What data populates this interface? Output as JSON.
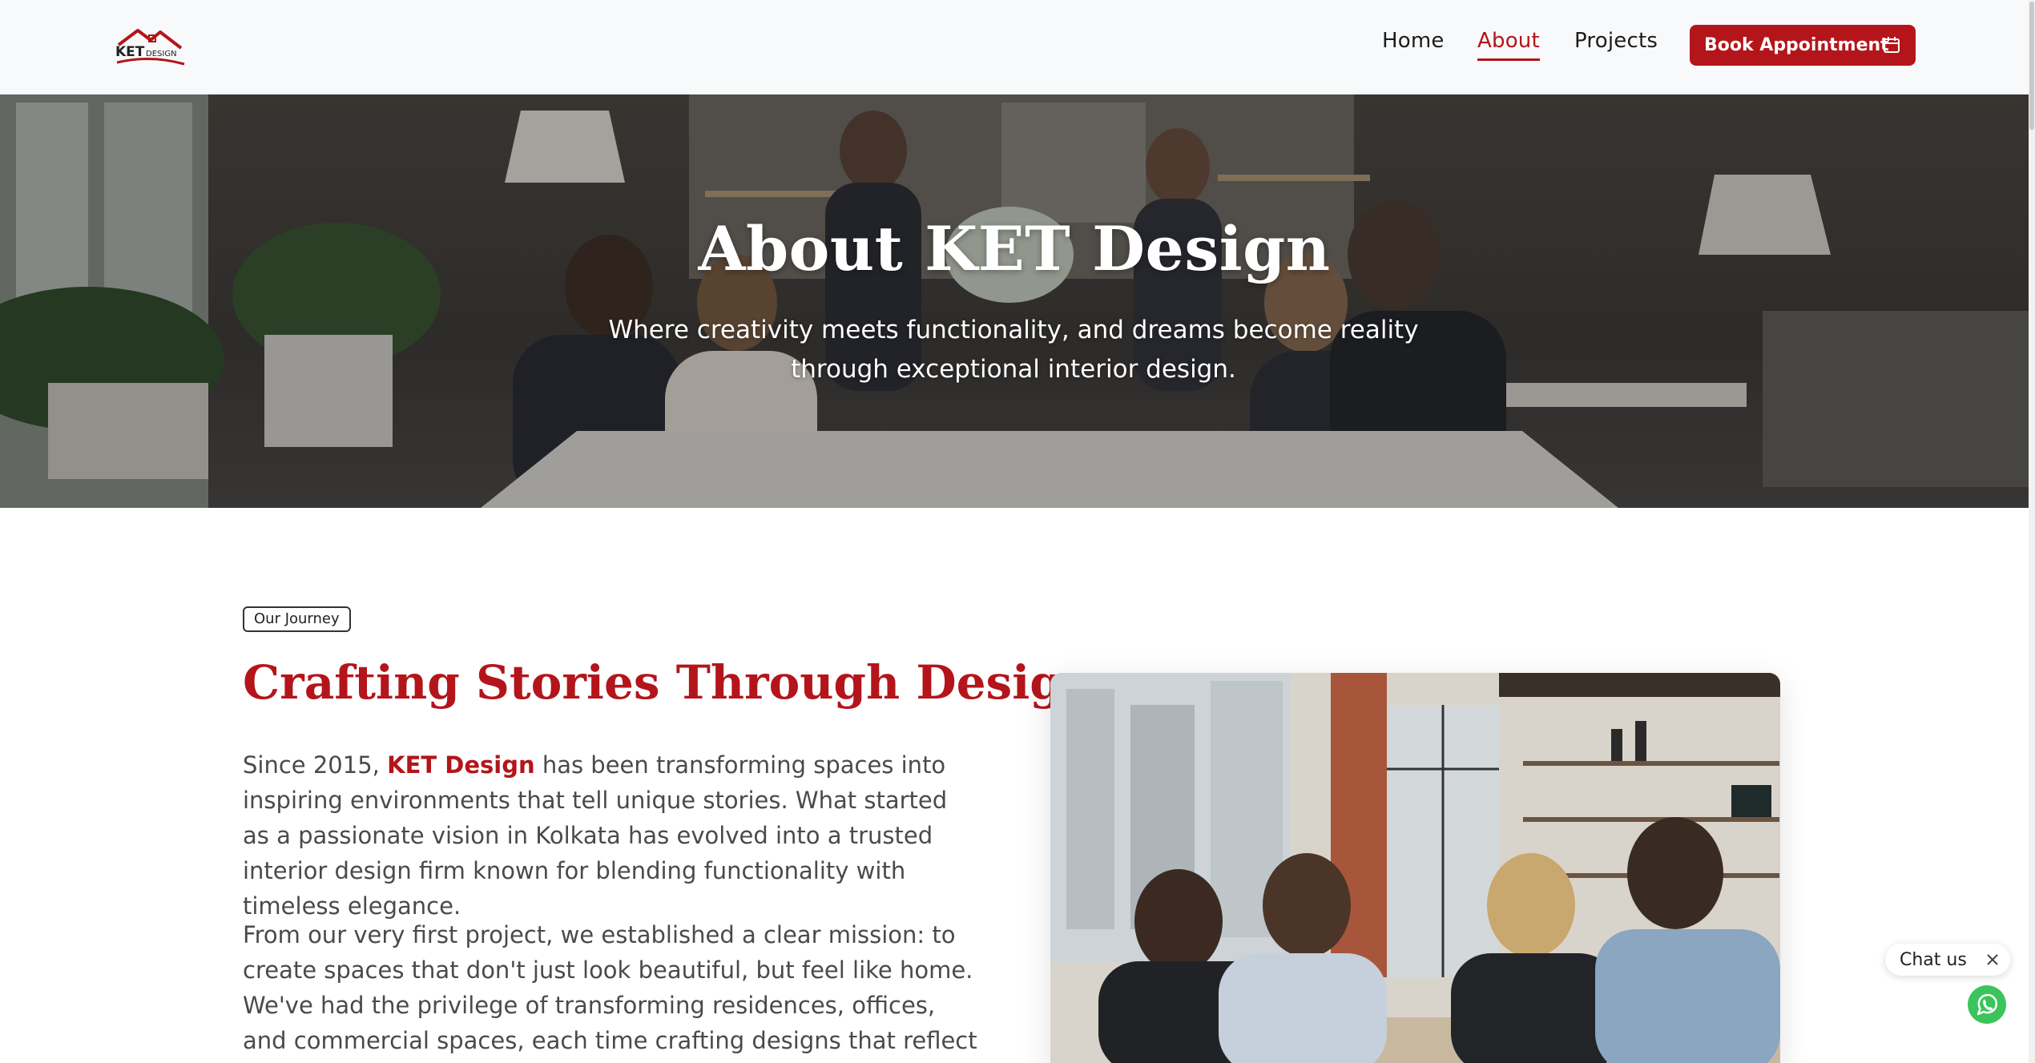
{
  "brand": {
    "logo_text": "KET DESIGN",
    "accent": "#b3151b"
  },
  "nav": {
    "items": [
      {
        "label": "Home",
        "active": false
      },
      {
        "label": "About",
        "active": true
      },
      {
        "label": "Projects",
        "active": false
      }
    ],
    "cta_label": "Book Appointment",
    "cta_icon": "calendar-icon"
  },
  "hero": {
    "title": "About KET Design",
    "subtitle": "Where creativity meets functionality, and dreams become reality through exceptional interior design."
  },
  "journey": {
    "badge": "Our Journey",
    "title": "Crafting Stories Through Design",
    "para1_prefix": "Since 2015, ",
    "para1_brand": "KET Design",
    "para1_suffix": " has been transforming spaces into inspiring environments that tell unique stories. What started as a passionate vision in Kolkata has evolved into a trusted interior design firm known for blending functionality with timeless elegance.",
    "para2": "From our very first project, we established a clear mission: to create spaces that don't just look beautiful, but feel like home. We've had the privilege of transforming residences, offices, and commercial spaces, each time crafting designs that reflect the personality and"
  },
  "chat": {
    "label": "Chat us",
    "icon": "whatsapp-icon"
  }
}
